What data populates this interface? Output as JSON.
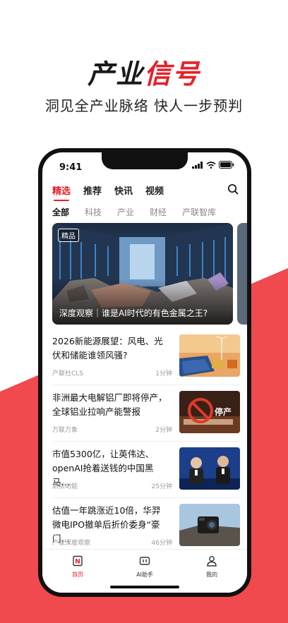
{
  "promo": {
    "logo_part1": "产业",
    "logo_part2": "信号",
    "tagline": "洞见全产业脉络 快人一步预判"
  },
  "status_bar": {
    "time": "9:41"
  },
  "top_tabs": [
    {
      "label": "精选",
      "active": true
    },
    {
      "label": "推荐",
      "active": false
    },
    {
      "label": "快讯",
      "active": false
    },
    {
      "label": "视频",
      "active": false
    }
  ],
  "sub_tabs": [
    {
      "label": "全部",
      "active": true
    },
    {
      "label": "科技",
      "active": false
    },
    {
      "label": "产业",
      "active": false
    },
    {
      "label": "财经",
      "active": false
    },
    {
      "label": "产联智库",
      "active": false
    }
  ],
  "hero": {
    "badge": "精品",
    "caption": "深度观察｜谁是AI时代的有色金属之王?"
  },
  "news": [
    {
      "title": "2026新能源展望：风电、光伏和储能谁领风骚?",
      "source": "产联社CLS",
      "duration": "1分钟"
    },
    {
      "title": "非洲最大电解铝厂即将停产，全球铝业拉响产能警报",
      "source": "万联万象",
      "duration": "2分钟"
    },
    {
      "title": "市值5300亿，让英伟达、openAI抢着送钱的中国黑马…",
      "source": "新质动能",
      "duration": "25分钟"
    },
    {
      "title": "估值一年跳涨近10倍，华羿微电IPO撤单后折价委身“豪门…",
      "source": "产联深度观察",
      "duration": "46分钟"
    }
  ],
  "bottom_nav": [
    {
      "label": "首页",
      "icon": "home-news-icon",
      "active": true
    },
    {
      "label": "AI助手",
      "icon": "ai-assistant-icon",
      "active": false
    },
    {
      "label": "我的",
      "icon": "profile-icon",
      "active": false
    }
  ],
  "colors": {
    "accent": "#e6202a",
    "background_red": "#f0494e"
  }
}
